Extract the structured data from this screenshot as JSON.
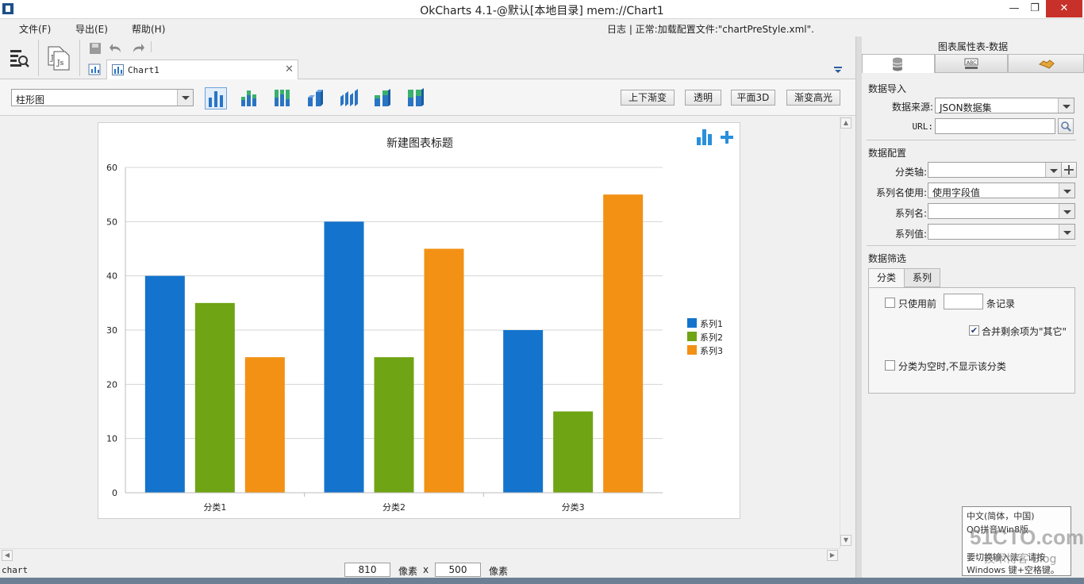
{
  "window": {
    "title": "OkCharts 4.1-@默认[本地目录]    mem://Chart1",
    "min_icon": "minimize-icon",
    "max_icon": "maximize-icon",
    "close_icon": "close-icon"
  },
  "menu": {
    "items": [
      "文件(F)",
      "导出(E)",
      "帮助(H)"
    ],
    "status": "日志  |  正常:加载配置文件:\"chartPreStyle.xml\"."
  },
  "doc_tab": {
    "label": "Chart1"
  },
  "chart_type_select": {
    "value": "柱形图"
  },
  "style_buttons": [
    "上下渐变",
    "透明",
    "平面3D",
    "渐变高光"
  ],
  "chart_data": {
    "type": "bar",
    "title": "新建图表标题",
    "categories": [
      "分类1",
      "分类2",
      "分类3"
    ],
    "series": [
      {
        "name": "系列1",
        "values": [
          40,
          50,
          30
        ],
        "color": "#1473CC"
      },
      {
        "name": "系列2",
        "values": [
          35,
          25,
          15
        ],
        "color": "#6FA414"
      },
      {
        "name": "系列3",
        "values": [
          25,
          45,
          55
        ],
        "color": "#F29114"
      }
    ],
    "yticks": [
      "0",
      "10",
      "20",
      "30",
      "40",
      "50",
      "60"
    ],
    "ylim": [
      0,
      60
    ],
    "grid": true,
    "legend": "right"
  },
  "statusbar": {
    "left": "chart",
    "width": "810",
    "unit1": "像素",
    "times": "x",
    "height": "500",
    "unit2": "像素"
  },
  "panel": {
    "title": "图表属性表-数据",
    "tabs": [
      "database-icon",
      "text-style-icon",
      "handshake-icon"
    ],
    "import_section": "数据导入",
    "source_label": "数据来源:",
    "source_value": "JSON数据集",
    "url_label": "URL:",
    "url_value": "",
    "config_section": "数据配置",
    "category_axis_label": "分类轴:",
    "series_name_use_label": "系列名使用:",
    "series_name_use_value": "使用字段值",
    "series_name_label": "系列名:",
    "series_value_label": "系列值:",
    "filter_section": "数据筛选",
    "filter_tabs": [
      "分类",
      "系列"
    ],
    "only_use_label": "只使用前",
    "records_label": "条记录",
    "merge_label": "合并剩余项为\"其它\"",
    "merge_checked": true,
    "hide_empty_label": "分类为空时,不显示该分类"
  },
  "ime": {
    "line1": "中文(简体，中国)",
    "line2": "QQ拼音Win8版",
    "line3": "要切换输入法，请按",
    "line4": "Windows 键+空格键。"
  },
  "watermark": {
    "logo": "51CTO.com",
    "sub": "技术博客 Blog"
  }
}
